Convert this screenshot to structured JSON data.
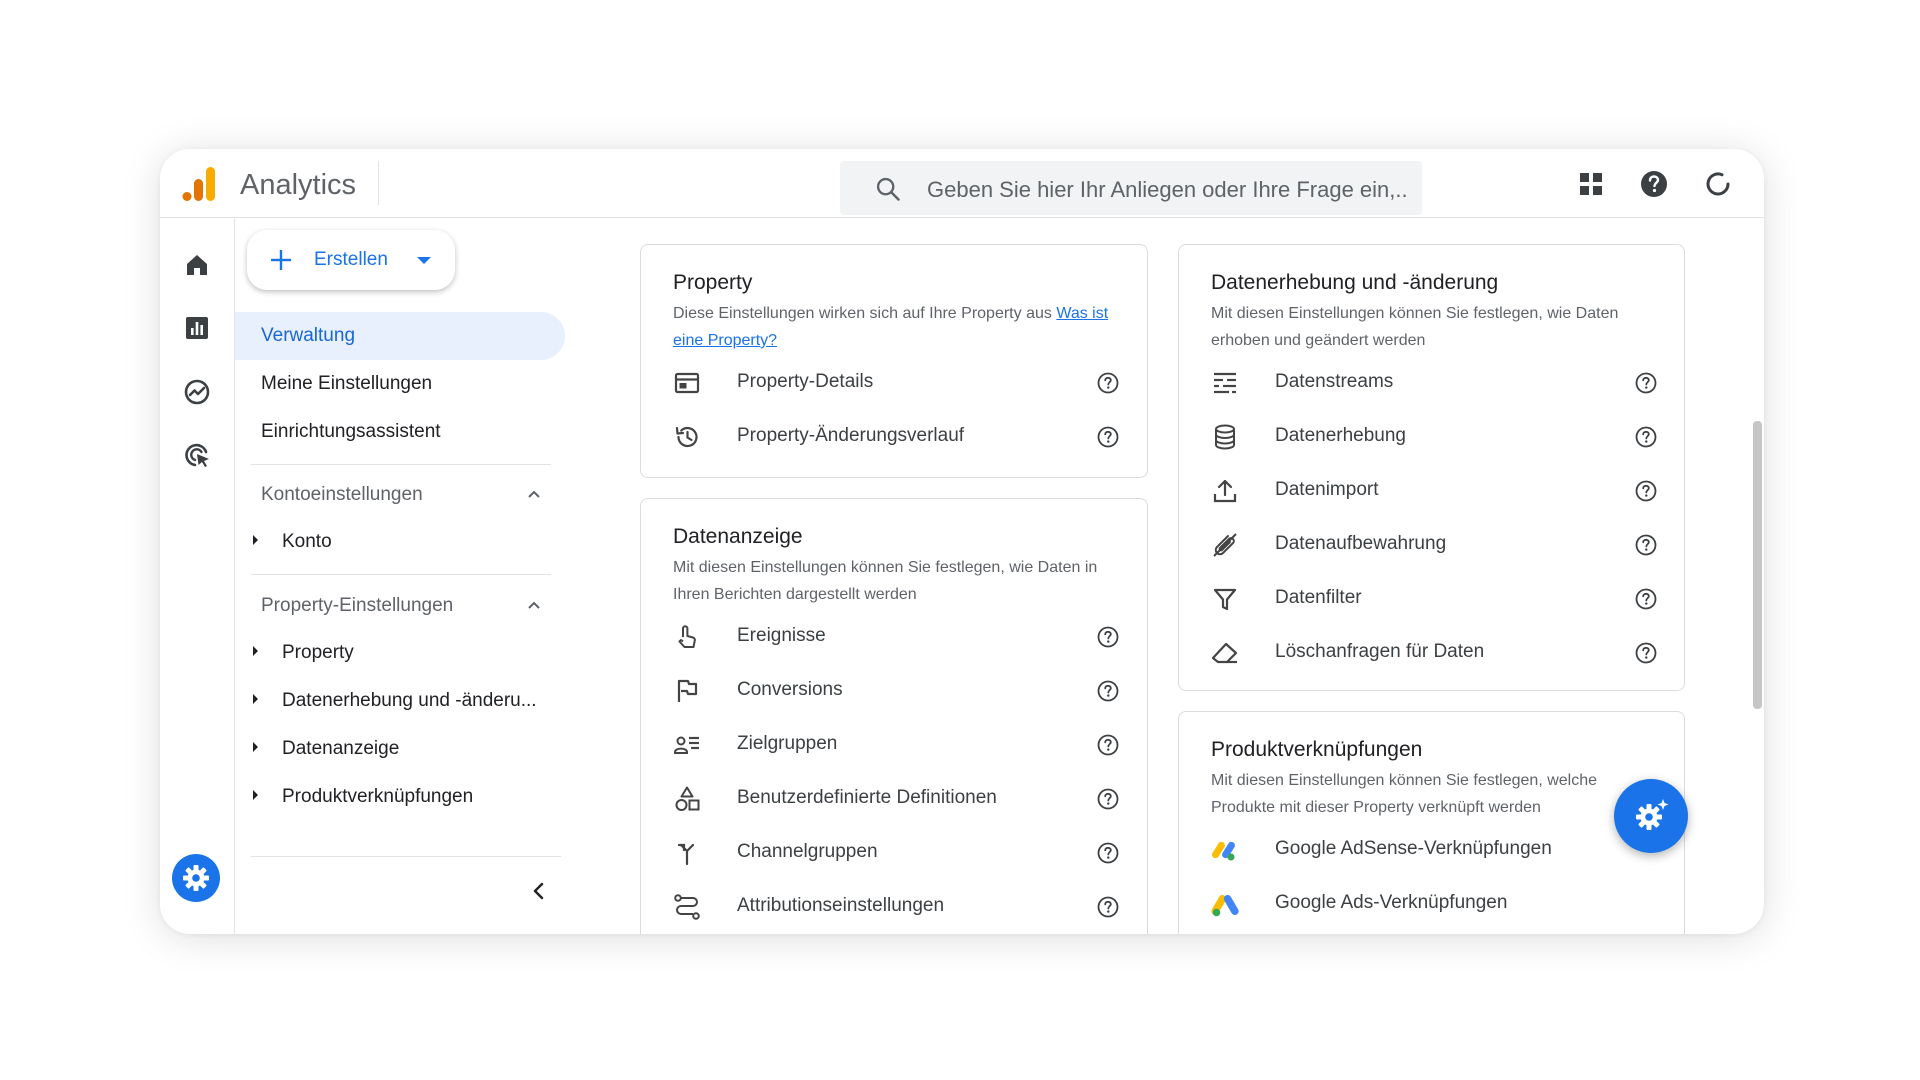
{
  "app": {
    "title": "Analytics"
  },
  "search": {
    "placeholder": "Geben Sie hier Ihr Anliegen oder Ihre Frage ein,..."
  },
  "topbar": {
    "icons": [
      "apps-grid-icon",
      "help-icon",
      "refresh-icon"
    ]
  },
  "rail": {
    "icons": [
      "home-icon",
      "reports-icon",
      "explore-icon",
      "advertising-icon",
      "admin-gear-icon"
    ]
  },
  "nav": {
    "create_label": "Erstellen",
    "items": [
      {
        "label": "Verwaltung",
        "active": true
      },
      {
        "label": "Meine Einstellungen"
      },
      {
        "label": "Einrichtungsassistent"
      }
    ],
    "account_section": {
      "label": "Kontoeinstellungen",
      "items": [
        "Konto"
      ]
    },
    "property_section": {
      "label": "Property-Einstellungen",
      "items": [
        "Property",
        "Datenerhebung und -änderu...",
        "Datenanzeige",
        "Produktverknüpfungen"
      ]
    }
  },
  "cards": {
    "property": {
      "title": "Property",
      "desc": "Diese Einstellungen wirken sich auf Ihre Property aus",
      "link": "Was ist eine Property?",
      "rows": [
        "Property-Details",
        "Property-Änderungsverlauf"
      ]
    },
    "display": {
      "title": "Datenanzeige",
      "desc": "Mit diesen Einstellungen können Sie festlegen, wie Daten in Ihren Berichten dargestellt werden",
      "rows": [
        "Ereignisse",
        "Conversions",
        "Zielgruppen",
        "Benutzerdefinierte Definitionen",
        "Channelgruppen",
        "Attributionseinstellungen"
      ]
    },
    "collection": {
      "title": "Datenerhebung und -änderung",
      "desc": "Mit diesen Einstellungen können Sie festlegen, wie Daten erhoben und geändert werden",
      "rows": [
        "Datenstreams",
        "Datenerhebung",
        "Datenimport",
        "Datenaufbewahrung",
        "Datenfilter",
        "Löschanfragen für Daten"
      ]
    },
    "links": {
      "title": "Produktverknüpfungen",
      "desc": "Mit diesen Einstellungen können Sie festlegen, welche Produkte mit dieser Property verknüpft werden",
      "rows": [
        "Google AdSense-Verknüpfungen",
        "Google Ads-Verknüpfungen"
      ]
    }
  },
  "colors": {
    "accent": "#1a73e8",
    "active_bg": "#e8f0fe",
    "logo_orange": "#f9ab00",
    "logo_dark_orange": "#e37400"
  }
}
